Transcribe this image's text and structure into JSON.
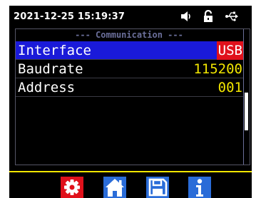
{
  "status_bar": {
    "datetime": "2021-12-25 15:19:37",
    "icons": [
      "speaker-icon",
      "lock-icon",
      "usb-icon"
    ]
  },
  "section": {
    "title": "--- Communication ---"
  },
  "settings": [
    {
      "label": "Interface",
      "value": "USB",
      "selected": true
    },
    {
      "label": "Baudrate",
      "value": "115200",
      "selected": false
    },
    {
      "label": "Address",
      "value": "001",
      "selected": false
    }
  ],
  "scroll": {
    "position": 0.65,
    "visible_fraction": 0.28
  },
  "toolbar": {
    "buttons": [
      {
        "icon": "gear-icon",
        "active": true
      },
      {
        "icon": "home-icon",
        "active": false
      },
      {
        "icon": "save-icon",
        "active": false
      },
      {
        "icon": "info-icon",
        "active": false
      }
    ]
  },
  "colors": {
    "screen_bg": "#000000",
    "selected_row": "#1a1ad9",
    "value_text": "#f2e600",
    "value_highlight": "#e0111b",
    "header_text": "#6b6f9a",
    "button_blue": "#2a6cd8",
    "button_red": "#e0111b",
    "separator": "#f2e600"
  }
}
